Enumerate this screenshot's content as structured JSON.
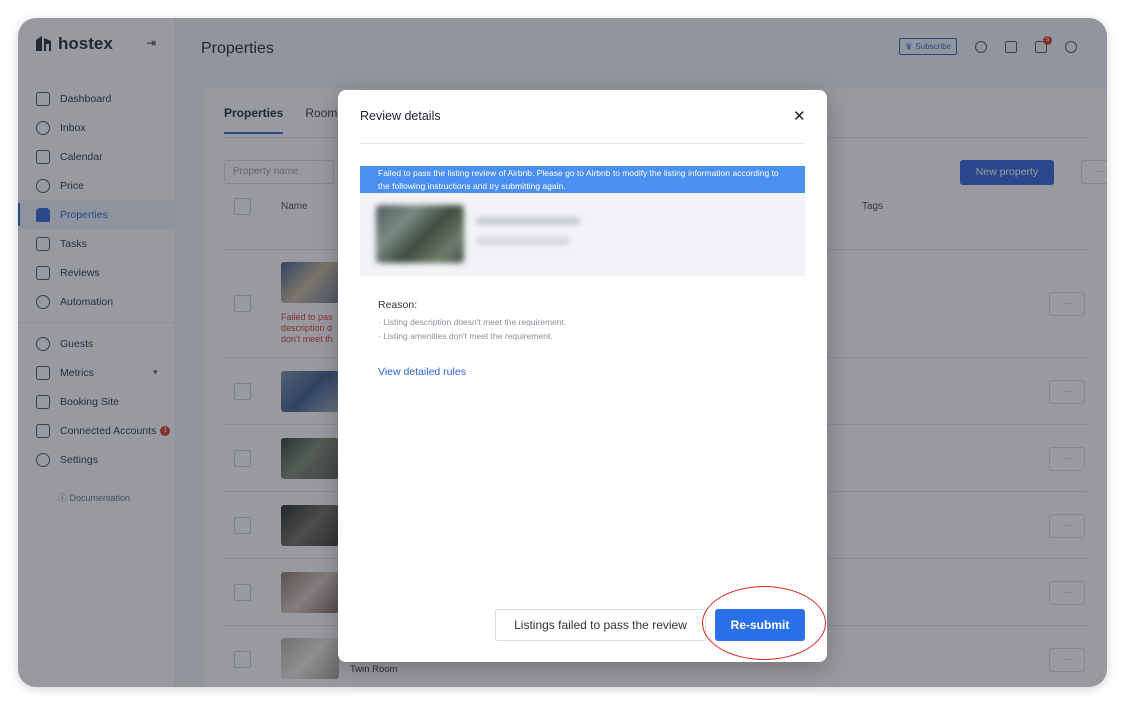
{
  "app": {
    "logo_text": "hostex"
  },
  "sidebar": {
    "items": [
      {
        "label": "Dashboard",
        "icon": "dashboard-icon"
      },
      {
        "label": "Inbox",
        "icon": "inbox-icon"
      },
      {
        "label": "Calendar",
        "icon": "calendar-icon"
      },
      {
        "label": "Price",
        "icon": "price-icon"
      },
      {
        "label": "Properties",
        "icon": "home-icon",
        "active": true
      },
      {
        "label": "Tasks",
        "icon": "tasks-icon"
      },
      {
        "label": "Reviews",
        "icon": "star-icon"
      },
      {
        "label": "Automation",
        "icon": "automation-icon"
      },
      {
        "label": "Guests",
        "icon": "user-icon"
      },
      {
        "label": "Metrics",
        "icon": "metrics-icon"
      },
      {
        "label": "Booking Site",
        "icon": "booking-site-icon"
      },
      {
        "label": "Connected Accounts",
        "icon": "connected-accounts-icon",
        "badge": "1"
      },
      {
        "label": "Settings",
        "icon": "settings-icon"
      }
    ],
    "documentation": "Documentation"
  },
  "header": {
    "title": "Properties",
    "subscribe": "Subscribe",
    "notification_count": "5"
  },
  "main": {
    "tabs": [
      "Properties",
      "Room"
    ],
    "search_placeholder": "Property name",
    "new_property": "New property",
    "more": "···",
    "columns": {
      "name": "Name",
      "tags": "Tags"
    },
    "row_fail_text": [
      "Failed to pas",
      "description d",
      "don't meet th"
    ],
    "last_row_name": "Twin Room"
  },
  "modal": {
    "title": "Review details",
    "close": "✕",
    "banner": "Failed to pass the listing review of Airbnb. Please go to Airbnb to modify the listing information according to the following instructions and try submitting again.",
    "reason_label": "Reason:",
    "reasons": [
      "· Listing description doesn't meet the requirement.",
      "· Listing amenities don't meet the requirement."
    ],
    "rules_link": "View detailed rules",
    "secondary_button": "Listings failed to pass the review",
    "primary_button": "Re-submit"
  },
  "colors": {
    "accent": "#2a62d6",
    "banner": "#4b8ff0",
    "danger": "#d9342b",
    "highlight_ellipse": "#e02a1f"
  }
}
